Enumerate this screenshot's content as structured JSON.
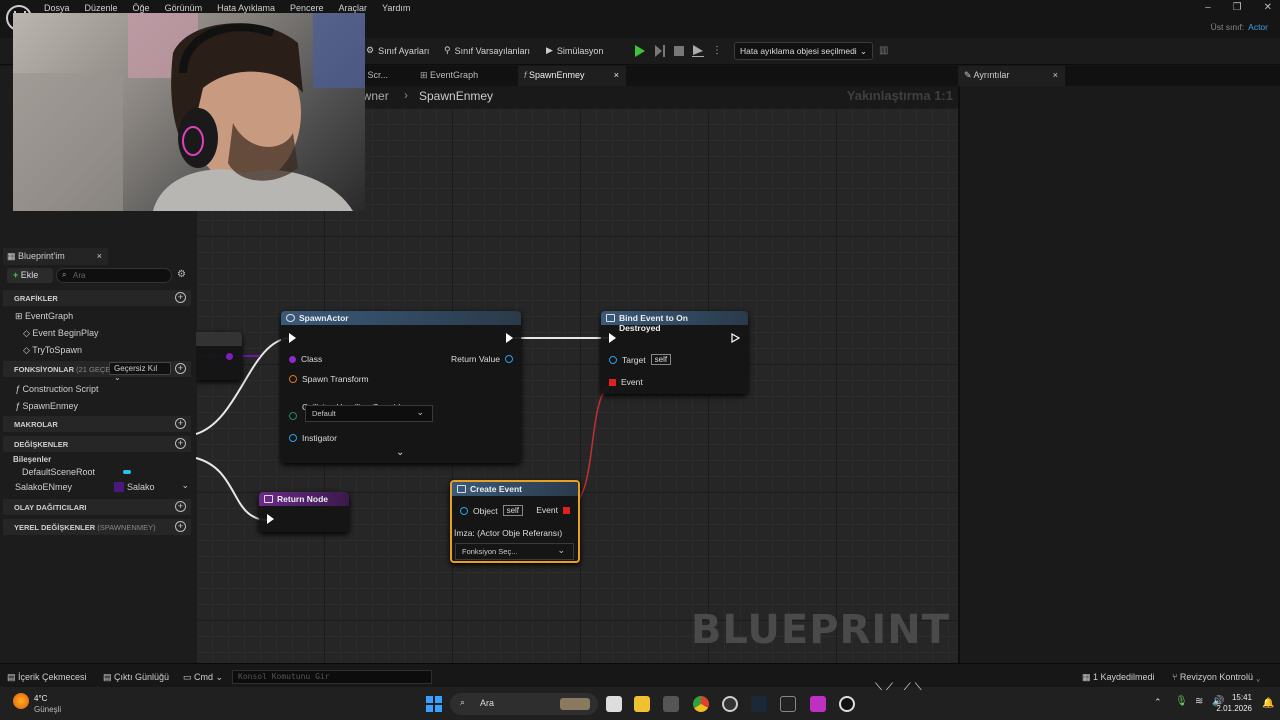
{
  "menu": [
    "Dosya",
    "Düzenle",
    "Öğe",
    "Görünüm",
    "Hata Ayıklama",
    "Pencere",
    "Araçlar",
    "Yardım"
  ],
  "parent_class": {
    "label": "Üst sınıf:",
    "value": "Actor"
  },
  "toolbar": {
    "class_settings": "Sınıf Ayarları",
    "class_defaults": "Sınıf Varsayılanları",
    "simulation": "Simülasyon",
    "debug_select": "Hata ayıklama objesi seçilmedi"
  },
  "tabs": {
    "construction": "n Scr...",
    "event_graph": "EventGraph",
    "spawn_enemy": "SpawnEnmey"
  },
  "breadcrumb": {
    "parent": "awner",
    "current": "SpawnEnmey"
  },
  "zoom": "Yakınlaştırma 1:1",
  "details_tab": "Ayrıntılar",
  "watermark": "BLUEPRINT",
  "my_blueprint": {
    "tab": "Blueprint'im",
    "add": "Ekle",
    "search_placeholder": "Ara",
    "sections": {
      "graphs": "GRAFİKLER",
      "functions": "FONKSİYONLAR",
      "functions_note": "(21 GEÇERSİ",
      "override": "Geçersiz Kıl",
      "macros": "MAKROLAR",
      "variables": "DEĞİŞKENLER",
      "dispatchers": "OLAY DAĞITICILARI",
      "local_vars": "YEREL DEĞİŞKENLER",
      "local_vars_note": "(SPAWNENMEY)"
    },
    "graph_items": {
      "event_graph": "EventGraph",
      "begin_play": "Event BeginPlay",
      "try_to_spawn": "TryToSpawn"
    },
    "function_items": {
      "construction": "Construction Script",
      "spawn": "SpawnEnmey"
    },
    "components_header": "Bileşenler",
    "components": {
      "root": "DefaultSceneRoot",
      "var_name": "SalakoENmey",
      "var_type": "Salako"
    }
  },
  "nodes": {
    "spawn_actor": {
      "title": "SpawnActor",
      "class": "Class",
      "return_value": "Return Value",
      "spawn_transform": "Spawn Transform",
      "collision": "Collision Handling Override",
      "collision_value": "Default",
      "instigator": "Instigator"
    },
    "bind_event": {
      "title": "Bind Event to On Destroyed",
      "target": "Target",
      "self": "self",
      "event": "Event"
    },
    "return_node": {
      "title": "Return Node"
    },
    "create_event": {
      "title": "Create Event",
      "object": "Object",
      "self": "self",
      "event": "Event",
      "signature": "İmza: (Actor Obje Referansı)",
      "function_select": "Fonksiyon Seç..."
    }
  },
  "statusbar": {
    "content_drawer": "İçerik Çekmecesi",
    "output_log": "Çıktı Günlüğü",
    "cmd": "Cmd",
    "console_placeholder": "Konsol Komutunu Gir",
    "saved": "1 Kaydedilmedi",
    "revision": "Revizyon Kontrolü"
  },
  "taskbar": {
    "weather_temp": "4°C",
    "weather_desc": "Güneşli",
    "search": "Ara",
    "time": "15:41",
    "date": "2.01.2026"
  },
  "colors": {
    "accent": "#3aa0e8",
    "graph_bg": "#262626",
    "create_event_border": "#e8a020",
    "event_pin": "#e02020"
  }
}
